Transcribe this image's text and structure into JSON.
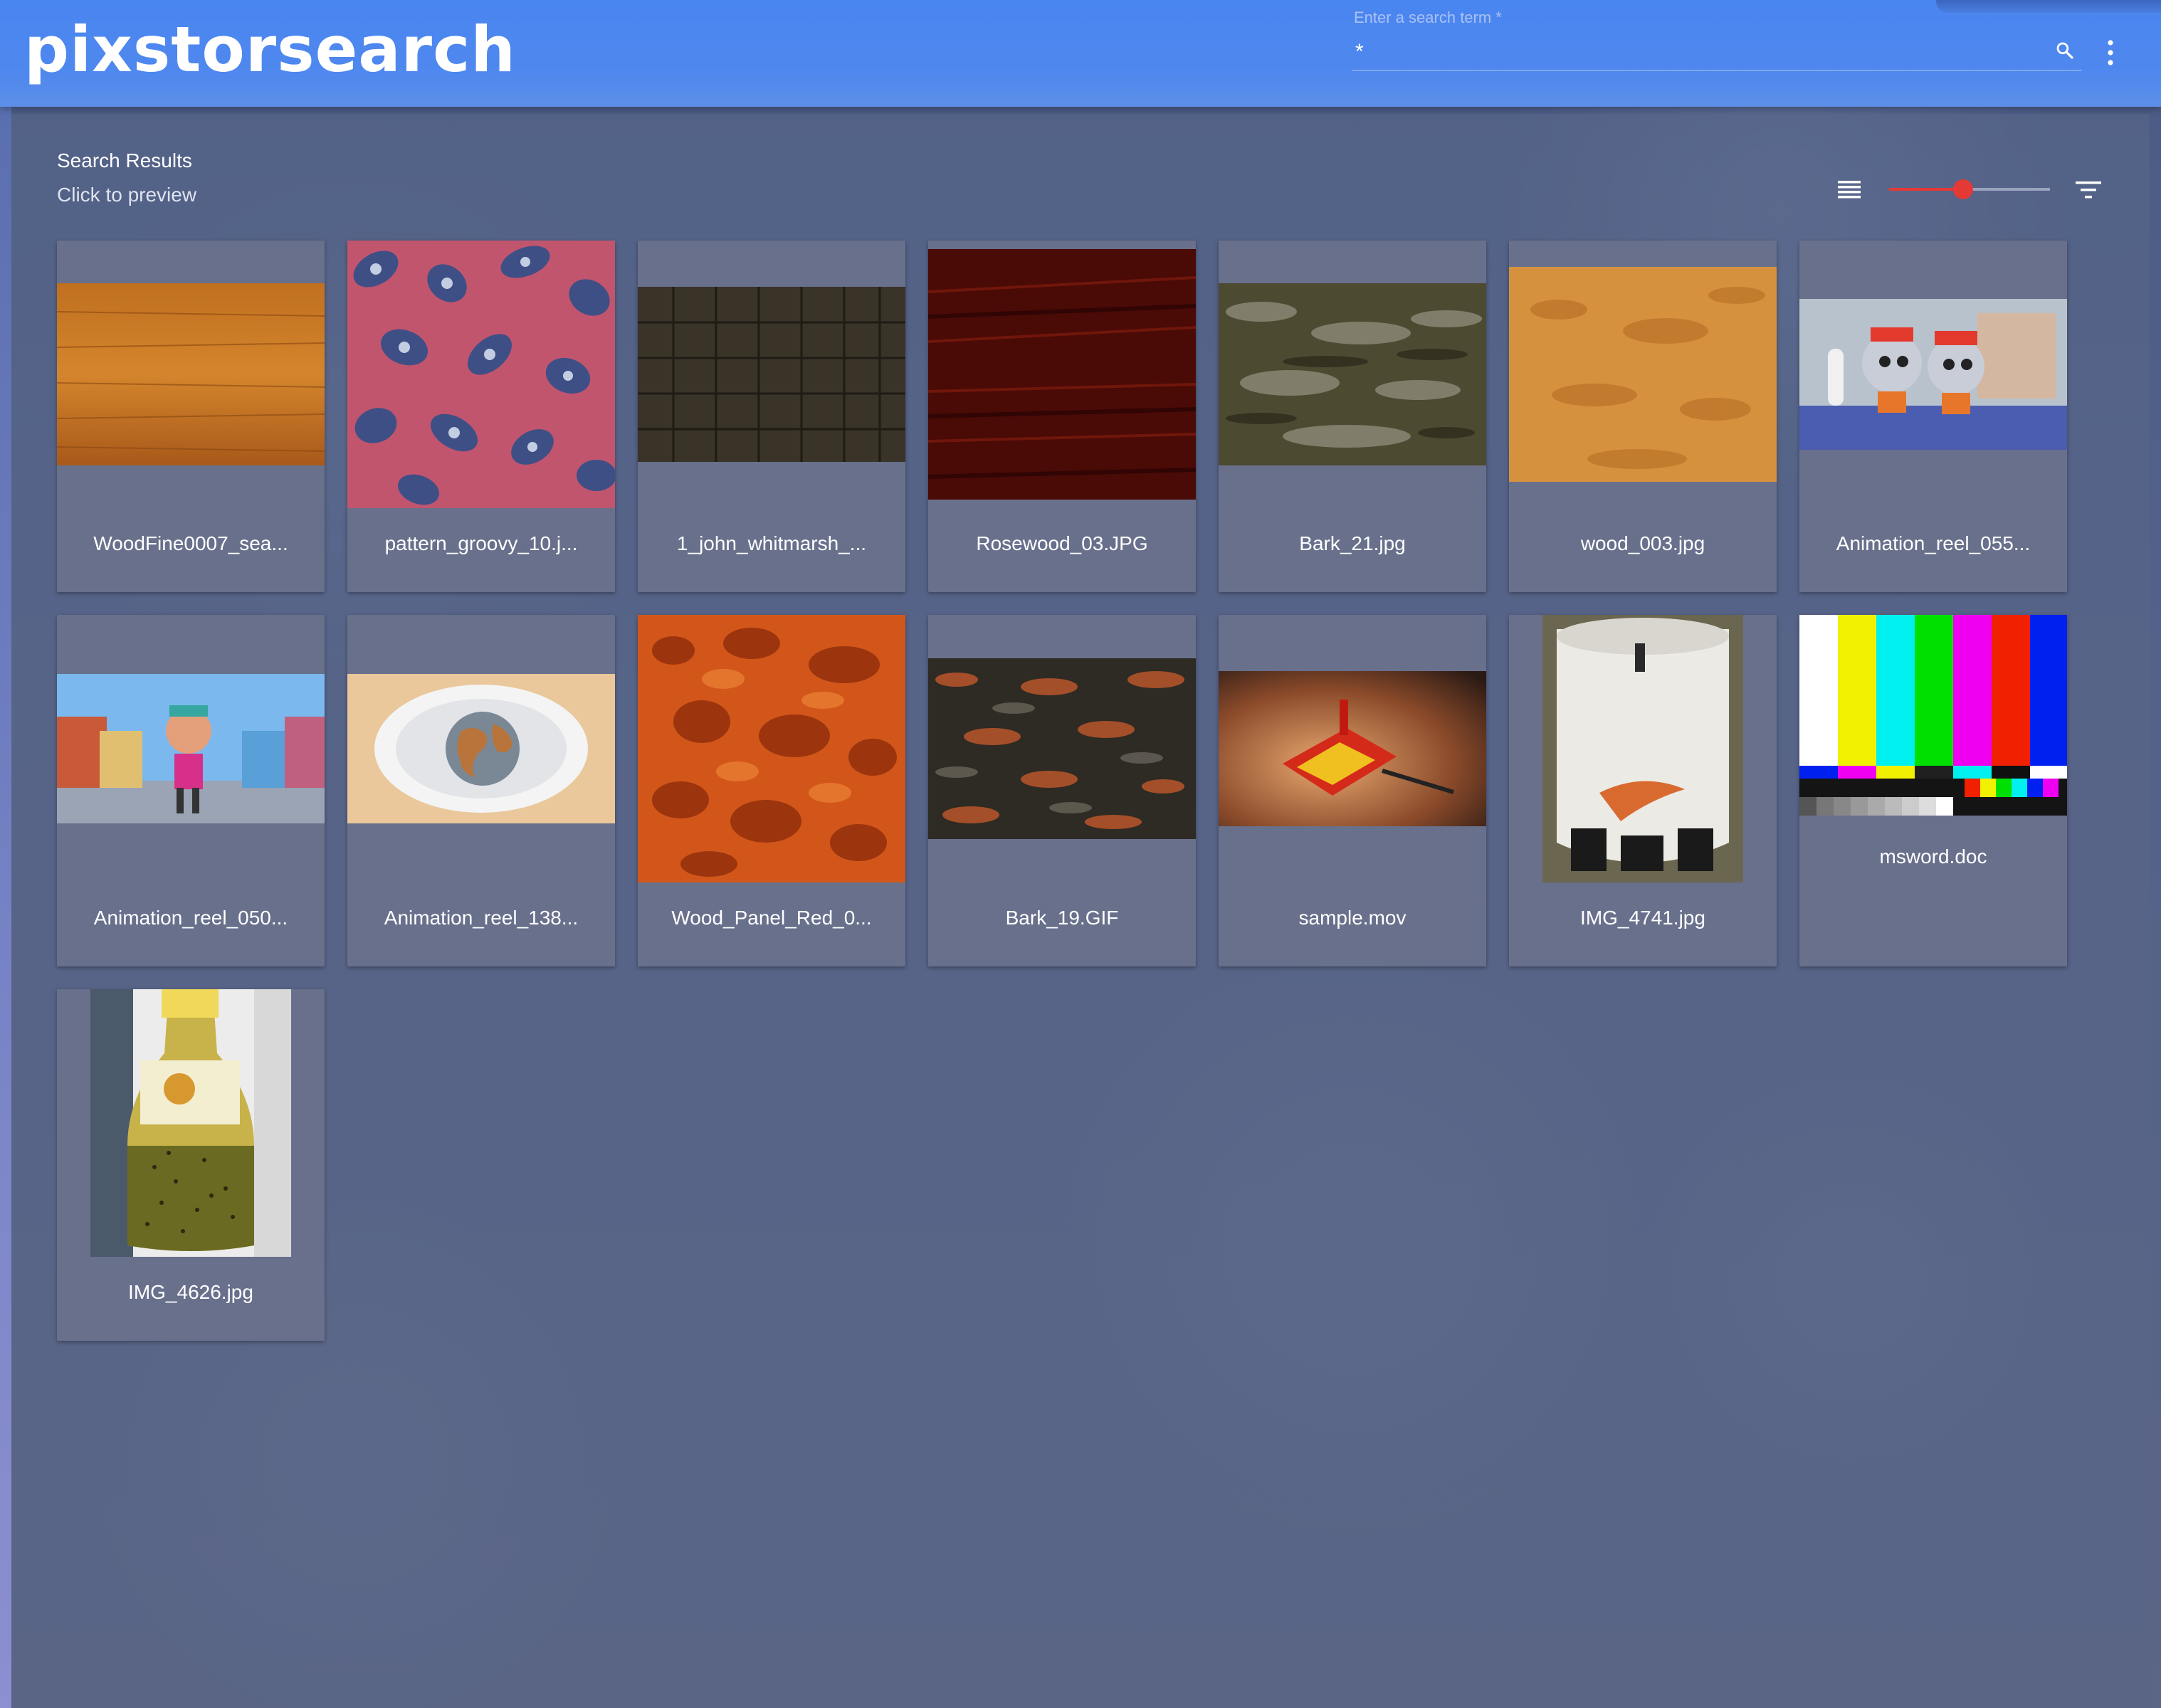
{
  "app": {
    "title": "pixstorsearch"
  },
  "search": {
    "label": "Enter a search term *",
    "value": "*",
    "placeholder": ""
  },
  "icons": {
    "search": "search-icon",
    "more": "more-vert-icon",
    "list_view": "list-view-icon",
    "filter": "filter-icon"
  },
  "results": {
    "title": "Search Results",
    "subtitle": "Click to preview",
    "thumbnail_size_slider": {
      "value_fraction": 0.46
    },
    "items": [
      {
        "name": "WoodFine0007_sea..."
      },
      {
        "name": "pattern_groovy_10.j..."
      },
      {
        "name": "1_john_whitmarsh_..."
      },
      {
        "name": "Rosewood_03.JPG"
      },
      {
        "name": "Bark_21.jpg"
      },
      {
        "name": "wood_003.jpg"
      },
      {
        "name": "Animation_reel_055..."
      },
      {
        "name": "Animation_reel_050..."
      },
      {
        "name": "Animation_reel_138..."
      },
      {
        "name": "Wood_Panel_Red_0..."
      },
      {
        "name": "Bark_19.GIF"
      },
      {
        "name": "sample.mov"
      },
      {
        "name": "IMG_4741.jpg"
      },
      {
        "name": "msword.doc"
      },
      {
        "name": "IMG_4626.jpg"
      }
    ]
  },
  "colors": {
    "app_bar": "#4a86f0",
    "accent": "#e53935",
    "card": "#68708c"
  }
}
